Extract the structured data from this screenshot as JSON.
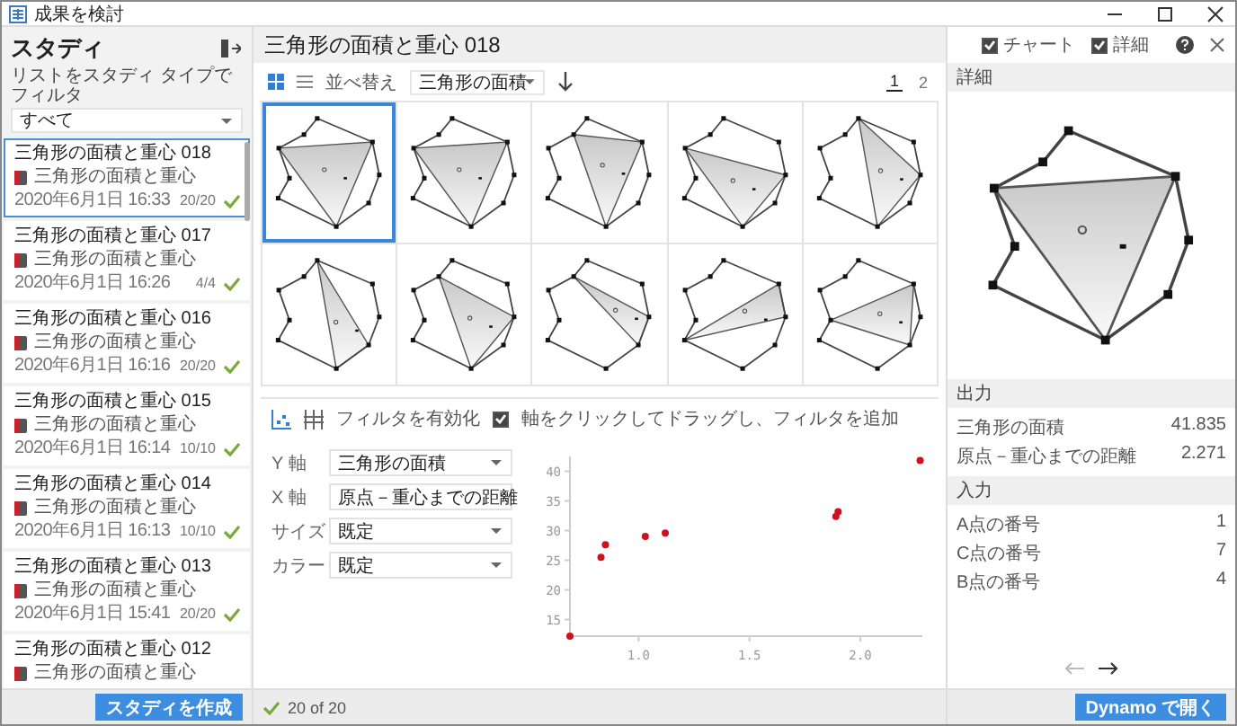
{
  "window": {
    "title": "成果を検討"
  },
  "studies_panel": {
    "title": "スタディ",
    "filter_label": "リストをスタディ タイプでフィルタ",
    "filter_value": "すべて",
    "create_button": "スタディを作成"
  },
  "studies": [
    {
      "title": "三角形の面積と重心 018",
      "type": "三角形の面積と重心",
      "date": "2020年6月1日 16:33",
      "count": "20/20",
      "selected": true
    },
    {
      "title": "三角形の面積と重心 017",
      "type": "三角形の面積と重心",
      "date": "2020年6月1日 16:26",
      "count": "4/4",
      "selected": false
    },
    {
      "title": "三角形の面積と重心 016",
      "type": "三角形の面積と重心",
      "date": "2020年6月1日 16:16",
      "count": "20/20",
      "selected": false
    },
    {
      "title": "三角形の面積と重心 015",
      "type": "三角形の面積と重心",
      "date": "2020年6月1日 16:14",
      "count": "10/10",
      "selected": false
    },
    {
      "title": "三角形の面積と重心 014",
      "type": "三角形の面積と重心",
      "date": "2020年6月1日 16:13",
      "count": "10/10",
      "selected": false
    },
    {
      "title": "三角形の面積と重心 013",
      "type": "三角形の面積と重心",
      "date": "2020年6月1日 15:41",
      "count": "20/20",
      "selected": false
    },
    {
      "title": "三角形の面積と重心 012",
      "type": "三角形の面積と重心",
      "selected": false
    }
  ],
  "header": {
    "title": "三角形の面積と重心 018"
  },
  "toolbar": {
    "views": [
      {
        "kind": "grid",
        "selected": true
      },
      {
        "kind": "list",
        "selected": false
      }
    ],
    "sort_label": "並べ替え",
    "sort_value": "三角形の面積",
    "pages": [
      {
        "label": "1",
        "selected": true
      },
      {
        "label": "2",
        "selected": false
      }
    ]
  },
  "thumbnails": [
    {
      "selected": true
    },
    {
      "selected": false
    },
    {
      "selected": false
    },
    {
      "selected": false
    },
    {
      "selected": false
    },
    {
      "selected": false
    },
    {
      "selected": false
    },
    {
      "selected": false
    },
    {
      "selected": false
    },
    {
      "selected": false
    }
  ],
  "filter_panel": {
    "views": [
      {
        "kind": "scatter",
        "selected": true
      },
      {
        "kind": "parallel",
        "selected": false
      }
    ],
    "filter_label": "フィルタを有効化",
    "filter_enabled": true,
    "hint": "軸をクリックしてドラッグし、フィルタを追加",
    "fields": [
      {
        "label": "Y 軸",
        "value": "三角形の面積",
        "kind": "dropdown"
      },
      {
        "label": "X 軸",
        "value": "原点－重心までの距離",
        "kind": "text"
      },
      {
        "label": "サイズ",
        "value": "既定",
        "kind": "dropdown"
      },
      {
        "label": "カラー",
        "value": "既定",
        "kind": "dropdown"
      }
    ],
    "chart_data": {
      "type": "scatter",
      "x": [
        0.69,
        0.83,
        0.85,
        1.03,
        1.12,
        1.89,
        1.9,
        2.27
      ],
      "values": [
        12.2,
        25.5,
        27.6,
        29.0,
        29.6,
        32.4,
        33.2,
        41.8
      ],
      "xlim": [
        0.69,
        2.28
      ],
      "ylim": [
        12.2,
        42.5
      ],
      "xticks": [
        {
          "value": 1,
          "label": "1.0"
        },
        {
          "value": 1.5,
          "label": "1.5"
        },
        {
          "value": 2,
          "label": "2.0"
        }
      ],
      "yticks": [
        15,
        20,
        25,
        30,
        35,
        40
      ]
    }
  },
  "status_bar": {
    "text": "20 of 20"
  },
  "panel_options": [
    {
      "label": "チャート",
      "checked": true
    },
    {
      "label": "詳細",
      "checked": true
    }
  ],
  "details": {
    "title": "詳細",
    "outputs_title": "出力",
    "outputs": [
      {
        "name": "三角形の面積",
        "value": "41.835"
      },
      {
        "name": "原点－重心までの距離",
        "value": "2.271"
      }
    ],
    "inputs_title": "入力",
    "inputs": [
      {
        "name": "A点の番号",
        "value": "1"
      },
      {
        "name": "C点の番号",
        "value": "7"
      },
      {
        "name": "B点の番号",
        "value": "4"
      }
    ],
    "open_button": "Dynamo で開く"
  },
  "navigation": {
    "previous_disabled": true,
    "next_disabled": false
  }
}
